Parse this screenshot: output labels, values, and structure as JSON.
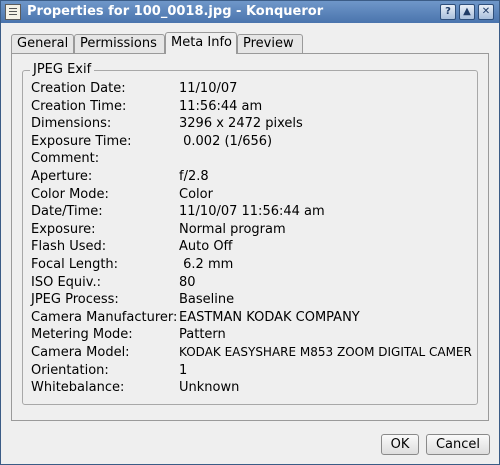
{
  "window": {
    "title": "Properties for 100_0018.jpg - Konqueror",
    "buttons": [
      "help-icon",
      "maximize-icon",
      "close-icon"
    ]
  },
  "tabs": [
    {
      "label": "General"
    },
    {
      "label": "Permissions"
    },
    {
      "label": "Meta Info"
    },
    {
      "label": "Preview"
    }
  ],
  "active_tab": "Meta Info",
  "group": {
    "title": "JPEG Exif",
    "rows": [
      {
        "key": "Creation Date:",
        "value": "11/10/07"
      },
      {
        "key": "Creation Time:",
        "value": "11:56:44 am"
      },
      {
        "key": "Dimensions:",
        "value": "3296 x 2472 pixels"
      },
      {
        "key": "Exposure Time:",
        "value": " 0.002 (1/656)"
      },
      {
        "key": "Comment:",
        "value": ""
      },
      {
        "key": "Aperture:",
        "value": "f/2.8"
      },
      {
        "key": "Color Mode:",
        "value": "Color"
      },
      {
        "key": "Date/Time:",
        "value": "11/10/07 11:56:44 am"
      },
      {
        "key": "Exposure:",
        "value": "Normal program"
      },
      {
        "key": "Flash Used:",
        "value": "Auto Off"
      },
      {
        "key": "Focal Length:",
        "value": " 6.2 mm"
      },
      {
        "key": "ISO Equiv.:",
        "value": "80"
      },
      {
        "key": "JPEG Process:",
        "value": "Baseline"
      },
      {
        "key": "Camera Manufacturer:",
        "value": "EASTMAN KODAK COMPANY"
      },
      {
        "key": "Metering Mode:",
        "value": "Pattern"
      },
      {
        "key": "Camera Model:",
        "value": "KODAK EASYSHARE M853 ZOOM DIGITAL CAMER"
      },
      {
        "key": "Orientation:",
        "value": "1"
      },
      {
        "key": "Whitebalance:",
        "value": "Unknown"
      }
    ]
  },
  "buttons": {
    "ok": "OK",
    "cancel": "Cancel"
  }
}
